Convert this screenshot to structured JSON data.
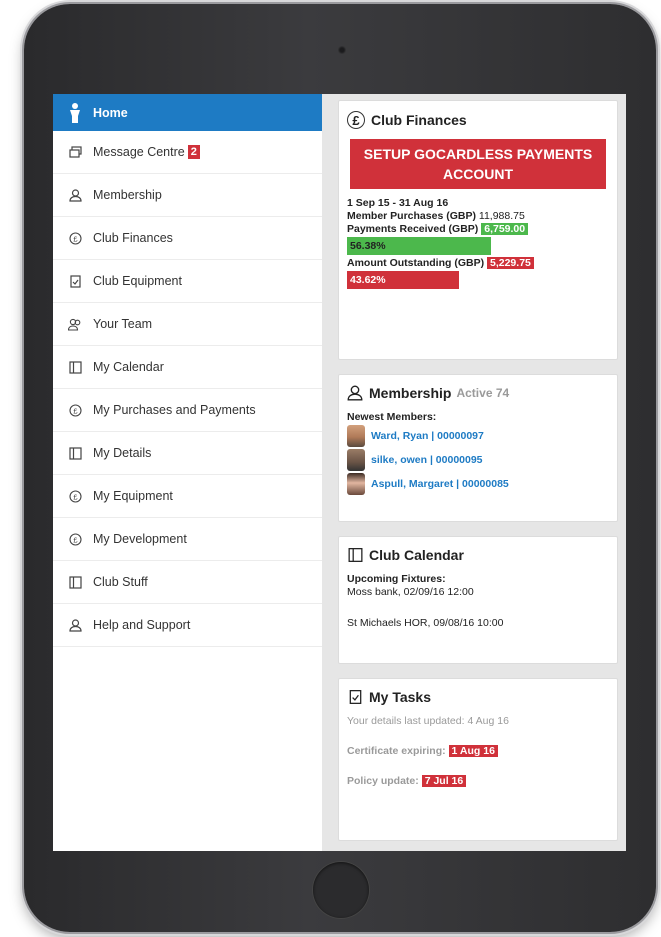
{
  "sidebar": {
    "items": [
      {
        "label": "Home",
        "icon": "person-icon",
        "active": true
      },
      {
        "label": "Message Centre",
        "icon": "messages-icon",
        "badge": "2"
      },
      {
        "label": "Membership",
        "icon": "user-icon"
      },
      {
        "label": "Club Finances",
        "icon": "pound-coin-icon"
      },
      {
        "label": "Club Equipment",
        "icon": "clipboard-icon"
      },
      {
        "label": "Your Team",
        "icon": "team-icon"
      },
      {
        "label": "My Calendar",
        "icon": "calendar-icon"
      },
      {
        "label": "My Purchases and Payments",
        "icon": "pound-coin-icon"
      },
      {
        "label": "My Details",
        "icon": "calendar-icon"
      },
      {
        "label": "My Equipment",
        "icon": "pound-coin-icon"
      },
      {
        "label": "My Development",
        "icon": "pound-coin-icon"
      },
      {
        "label": "Club Stuff",
        "icon": "calendar-icon"
      },
      {
        "label": "Help and Support",
        "icon": "user-icon"
      }
    ]
  },
  "finances": {
    "title": "Club Finances",
    "setup_button": "SETUP GOCARDLESS PAYMENTS ACCOUNT",
    "period": "1 Sep 15 - 31 Aug 16",
    "purchases_label": "Member Purchases (GBP)",
    "purchases_value": "11,988.75",
    "received_label": "Payments Received (GBP)",
    "received_value": "6,759.00",
    "received_pct": "56.38%",
    "received_fraction": 0.5638,
    "outstanding_label": "Amount Outstanding (GBP)",
    "outstanding_value": "5,229.75",
    "outstanding_pct": "43.62%",
    "outstanding_fraction": 0.4362
  },
  "membership": {
    "title": "Membership",
    "active_label": "Active 74",
    "newest_label": "Newest Members:",
    "members": [
      {
        "name": "Ward, Ryan | 00000097"
      },
      {
        "name": "silke, owen | 00000095"
      },
      {
        "name": "Aspull, Margaret | 00000085"
      }
    ]
  },
  "calendar": {
    "title": "Club Calendar",
    "upcoming_label": "Upcoming Fixtures:",
    "fixtures": [
      "Moss bank, 02/09/16 12:00",
      "St Michaels HOR, 09/08/16 10:00"
    ]
  },
  "tasks": {
    "title": "My Tasks",
    "details_updated": "Your details last updated: 4 Aug 16",
    "certificate_label": "Certificate expiring:",
    "certificate_date": "1 Aug 16",
    "policy_label": "Policy update:",
    "policy_date": "7 Jul 16"
  },
  "colors": {
    "accent": "#1e7bc4",
    "danger": "#d0313a",
    "success": "#4cb84c"
  }
}
